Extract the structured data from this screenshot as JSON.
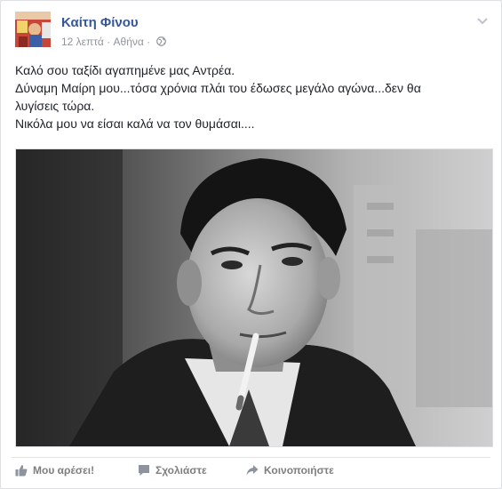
{
  "post": {
    "author": "Καίτη Φίνου",
    "time": "12 λεπτά",
    "separator": "·",
    "location": "Αθήνα",
    "privacy_icon": "globe-icon",
    "options_icon": "chevron-down-icon",
    "body_lines": [
      "Καλό σου ταξίδι αγαπημένε μας Αντρέα.",
      "Δύναμη Μαίρη μου...τόσα χρόνια πλάι του έδωσες μεγάλο αγώνα...δεν θα",
      "λυγίσεις τώρα.",
      "Νικόλα μου να είσαι καλά να τον θυμάσαι...."
    ]
  },
  "actions": {
    "like": {
      "label": "Μου αρέσει!",
      "icon": "thumbs-up-icon"
    },
    "comment": {
      "label": "Σχολιάστε",
      "icon": "comment-icon"
    },
    "share": {
      "label": "Κοινοποιήστε",
      "icon": "share-icon"
    }
  },
  "colors": {
    "author_link": "#365899",
    "meta_text": "#90949c",
    "body_text": "#1d2129",
    "action_text": "#7f7f7f"
  }
}
